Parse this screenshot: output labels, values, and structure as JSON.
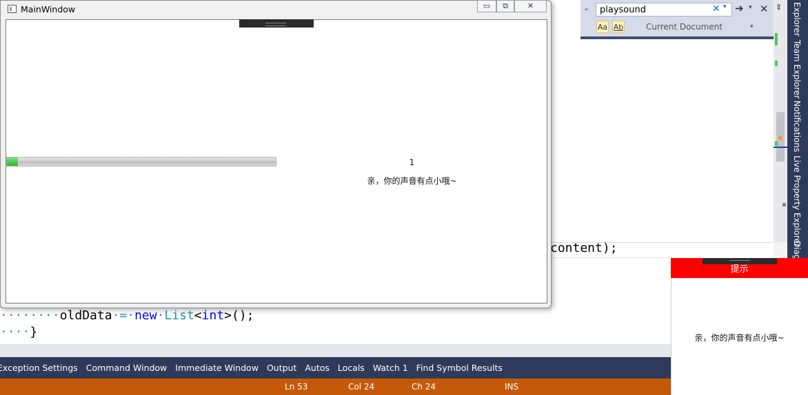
{
  "main_window": {
    "title": "MainWindow",
    "minimize_glyph": "▭",
    "maximize_glyph": "⧉",
    "close_glyph": "✕",
    "progress_fraction": 0.01,
    "count": "1",
    "message": "亲，你的声音有点小哦~"
  },
  "editor": {
    "line_content": "content);",
    "line_olddata_indent": "········",
    "line_olddata_var": "oldData",
    "line_olddata_eq": "·=·",
    "line_olddata_new": "new",
    "line_olddata_type": "List",
    "line_olddata_generic_open": "<",
    "line_olddata_int": "int",
    "line_olddata_rest": ">();",
    "line_brace_indent": "····",
    "line_brace": "}"
  },
  "find": {
    "query": "playsound",
    "clear_glyph": "✕",
    "dropdown_glyph": "▾",
    "expand_glyph": "⌄",
    "next_glyph": "➔",
    "close_glyph": "✕",
    "match_case_label": "Aa",
    "match_word_label": "Ab",
    "scope": "Current Document"
  },
  "bottom_tabs": [
    "Exception Settings",
    "Command Window",
    "Immediate Window",
    "Output",
    "Autos",
    "Locals",
    "Watch 1",
    "Find Symbol Results"
  ],
  "status_bar": {
    "line": "Ln 53",
    "col": "Col 24",
    "ch": "Ch 24",
    "mode": "INS"
  },
  "right_tool_tabs": [
    "Explorer",
    "Team Explorer",
    "Notifications",
    "Live Property Explorer",
    "Diag"
  ],
  "tip_window": {
    "title": "提示",
    "message": "亲，你的声音有点小哦~"
  },
  "colors": {
    "status_bar": "#c45a09",
    "tabs_bar": "#2d3a5a",
    "tip_header": "#ff0000",
    "progress_fill": "#2fb12f"
  }
}
